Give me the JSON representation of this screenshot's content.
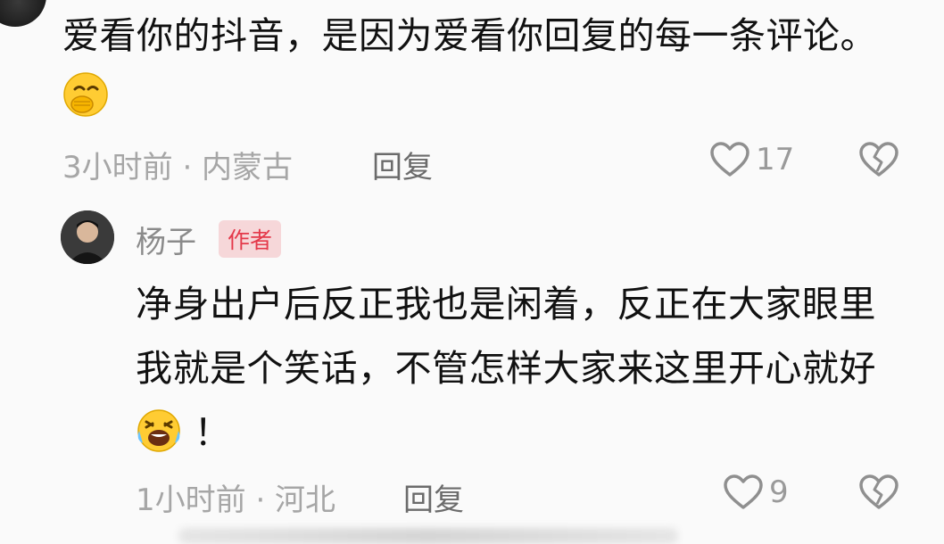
{
  "comment_top": {
    "text": "爱看你的抖音，是因为爱看你回复的每一条评论。",
    "time_location": "3小时前 · 内蒙古",
    "reply_label": "回复",
    "like_count": "17",
    "emoji_icon": "hand-over-mouth-emoji"
  },
  "reply": {
    "username": "杨子",
    "badge": "作者",
    "text": "净身出户后反正我也是闲着，反正在大家眼里我就是个笑话，不管怎样大家来这里开心就好",
    "text_end": "！",
    "time_location": "1小时前 · 河北",
    "reply_label": "回复",
    "like_count": "9",
    "emoji_icon": "rolling-laughing-emoji"
  },
  "colors": {
    "badge_text": "#e4394a",
    "badge_bg": "#f6d7d9",
    "meta_text": "#a6a6a6"
  }
}
